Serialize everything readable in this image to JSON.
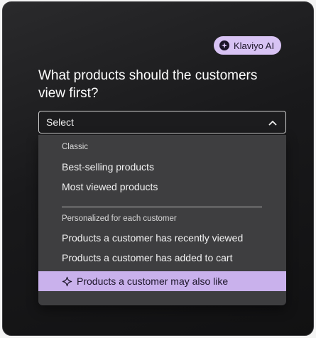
{
  "badge": {
    "label": "Klaviyo AI",
    "icon": "sparkle-icon"
  },
  "question": "What products should the customers view first?",
  "select": {
    "value": "Select",
    "icon": "chevron-up-icon"
  },
  "dropdown": {
    "groups": [
      {
        "label": "Classic",
        "options": [
          "Best-selling products",
          "Most viewed products"
        ]
      },
      {
        "label": "Personalized for each customer",
        "options": [
          "Products a customer has recently viewed",
          "Products a customer has added to cart",
          "Products a customer may also like"
        ]
      }
    ],
    "highlighted_option": "Products a customer may also like"
  },
  "colors": {
    "card_background": "#1a1a1c",
    "accent_purple": "#d8c3f4",
    "highlight_purple": "#c9b1ec",
    "dropdown_background": "#3e3e40"
  }
}
